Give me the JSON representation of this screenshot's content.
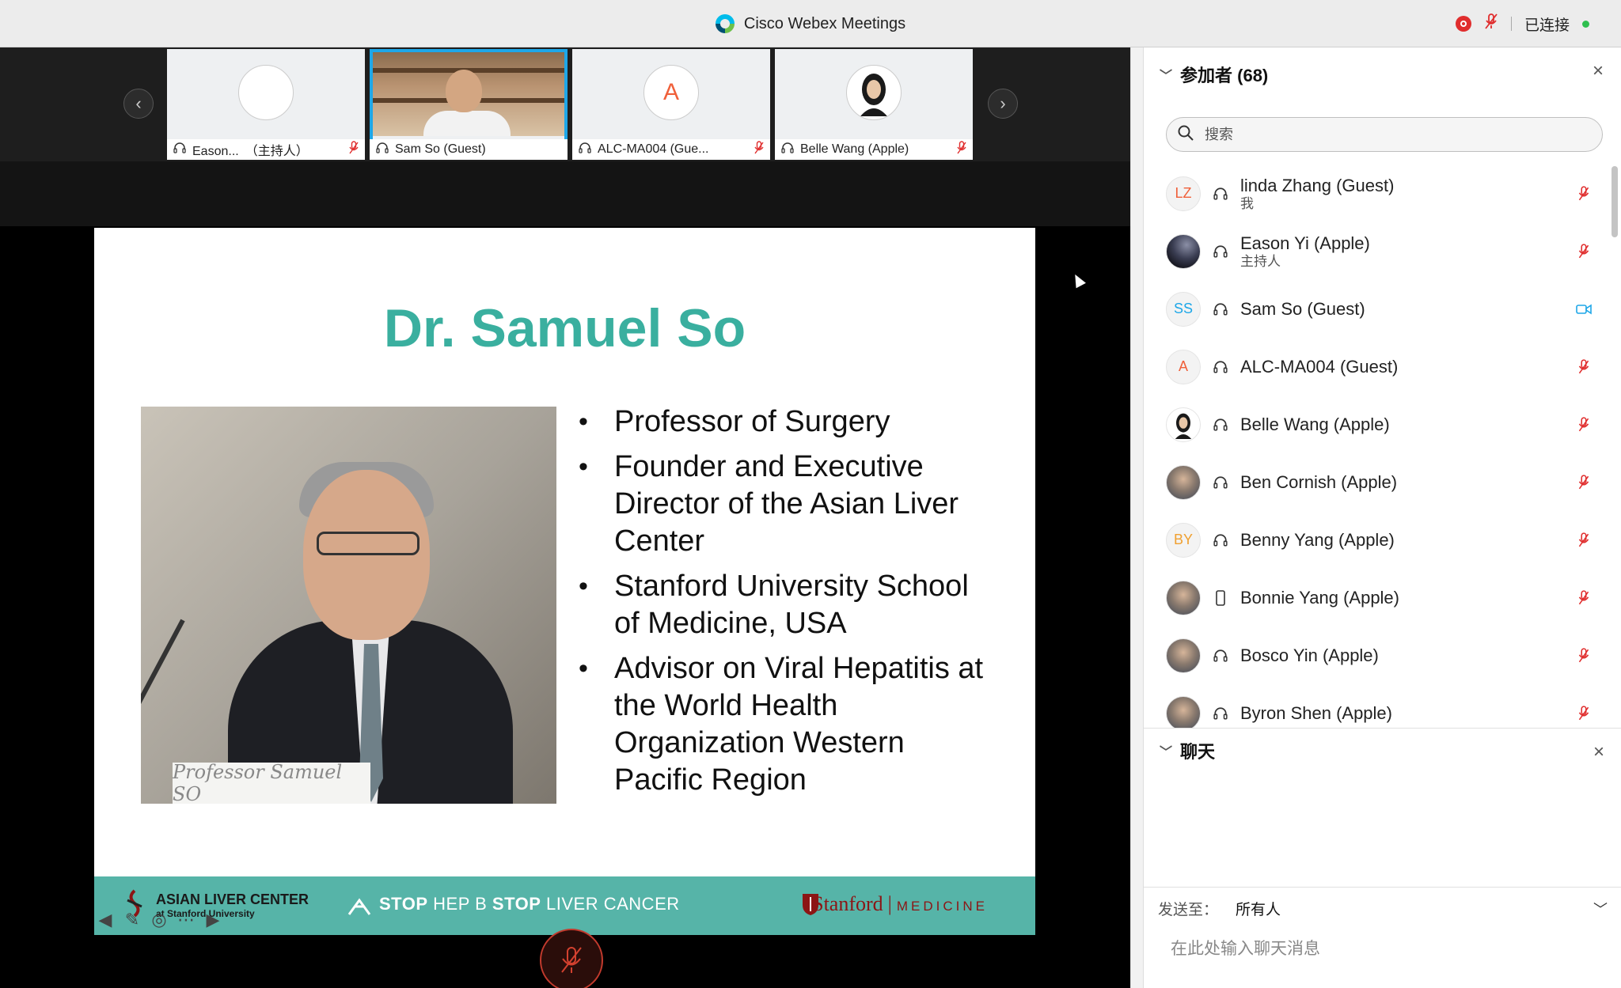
{
  "window": {
    "title": "Cisco Webex Meetings",
    "status_text": "已连接",
    "colors": {
      "accent": "#1ea7e8",
      "muted_red": "#e02d2d",
      "connected_green": "#2fbf4f",
      "slide_teal": "#3aaf9f",
      "footer_teal": "#56b4a8"
    }
  },
  "thumbnails": [
    {
      "name": "Eason...",
      "role": "（主持人）",
      "avatar": "night-sky-avatar",
      "muted": true
    },
    {
      "name": "Sam So (Guest)",
      "active": true,
      "video": true,
      "muted": false
    },
    {
      "name": "ALC-MA004 (Gue...",
      "initials": "A",
      "muted": true
    },
    {
      "name": "Belle Wang (Apple)",
      "avatar": "girl-avatar",
      "muted": true
    }
  ],
  "slide": {
    "title": "Dr. Samuel So",
    "photo_caption": "Professor Samuel SO",
    "bullets": [
      "Professor of Surgery",
      "Founder and Executive Director of the Asian Liver Center",
      "Stanford University School of Medicine, USA",
      "Advisor on Viral Hepatitis at the World Health Organization Western Pacific Region"
    ],
    "footer": {
      "alc_name": "ASIAN LIVER CENTER",
      "alc_sub": "at Stanford University",
      "stop1_bold": "STOP",
      "stop1": "HEP B",
      "stop2_bold": "STOP",
      "stop2": "LIVER CANCER",
      "stanford": "Stanford",
      "medicine": "MEDICINE"
    }
  },
  "participants_panel": {
    "title": "参加者 (68)",
    "search_placeholder": "搜索",
    "participants": [
      {
        "name": "linda Zhang (Guest)",
        "role": "我",
        "initials": "LZ",
        "initials_color": "#f0603a",
        "device": "headset-icon",
        "status": "mic-muted-icon"
      },
      {
        "name": "Eason Yi (Apple)",
        "role": "主持人",
        "avatar": "night-sky-avatar",
        "device": "headset-icon",
        "status": "mic-muted-icon"
      },
      {
        "name": "Sam So (Guest)",
        "initials": "SS",
        "initials_color": "#1ea7e8",
        "device": "headset-icon",
        "status": "video-camera-icon"
      },
      {
        "name": "ALC-MA004 (Guest)",
        "initials": "A",
        "initials_color": "#f0603a",
        "device": "headset-icon",
        "status": "mic-muted-icon"
      },
      {
        "name": "Belle Wang (Apple)",
        "avatar": "girl-avatar",
        "device": "headset-icon",
        "status": "mic-muted-icon"
      },
      {
        "name": "Ben Cornish (Apple)",
        "avatar": "photo-avatar",
        "device": "headset-icon",
        "status": "mic-muted-icon"
      },
      {
        "name": "Benny Yang (Apple)",
        "initials": "BY",
        "initials_color": "#f0a030",
        "device": "headset-icon",
        "status": "mic-muted-icon"
      },
      {
        "name": "Bonnie Yang (Apple)",
        "avatar": "photo-avatar",
        "device": "phone-icon",
        "status": "mic-muted-icon"
      },
      {
        "name": "Bosco Yin (Apple)",
        "avatar": "photo-avatar",
        "device": "headset-icon",
        "status": "mic-muted-icon"
      },
      {
        "name": "Byron Shen (Apple)",
        "avatar": "photo-avatar",
        "device": "headset-icon",
        "status": "mic-muted-icon"
      }
    ]
  },
  "chat_panel": {
    "title": "聊天",
    "send_to_label": "发送至：",
    "send_to_value": "所有人",
    "input_placeholder": "在此处输入聊天消息"
  }
}
